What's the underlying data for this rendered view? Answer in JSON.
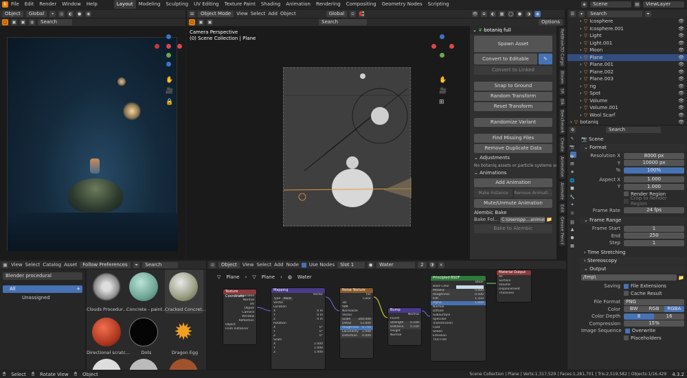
{
  "menu": [
    "File",
    "Edit",
    "Render",
    "Window",
    "Help"
  ],
  "workspaces": [
    "Layout",
    "Modeling",
    "Sculpting",
    "UV Editing",
    "Texture Paint",
    "Shading",
    "Animation",
    "Rendering",
    "Compositing",
    "Geometry Nodes",
    "Scripting"
  ],
  "active_workspace": "Layout",
  "top_right": {
    "scene": "Scene",
    "view_layer": "ViewLayer"
  },
  "left_viewport": {
    "mode": "Object",
    "orientation": "Global",
    "search": "Search"
  },
  "main_viewport": {
    "mode": "Object Mode",
    "menus": [
      "View",
      "Select",
      "Add",
      "Object"
    ],
    "orientation": "Global",
    "camera_label": "Camera Perspective",
    "collection_label": "(0) Scene Collection | Plane",
    "options": "Options",
    "search": "Search"
  },
  "npanel": {
    "title": "botaniq full",
    "buttons": {
      "spawn": "Spawn Asset",
      "convert_editable": "Convert to Editable",
      "convert_linked": "Convert to Linked",
      "snap": "Snap to Ground",
      "random_transform": "Random Transform",
      "reset_transform": "Reset Transform",
      "randomize_variant": "Randomize Variant",
      "find_missing": "Find Missing Files",
      "remove_duplicate": "Remove Duplicate Data",
      "add_animation": "Add Animation",
      "make_instance": "Make Instance",
      "remove_animation": "Remove Animati...",
      "mute_unmute": "Mute/Unmute Animation",
      "bake_alembic": "Bake to Alembic"
    },
    "adjustments_label": "Adjustments",
    "no_assets_msg": "No botaniq assets or particle systems sel...",
    "animations_label": "Animations",
    "alembic_label": "Alembic Bake",
    "bake_folder_label": "Bake Fol...",
    "bake_folder_path": "C:\\Users\\pp....animations"
  },
  "side_tabs": [
    "RetBrain3D Cargo",
    "Bloom",
    "SR",
    "Blk",
    "Benchmark",
    "Create",
    "Animation",
    "Animate",
    "Edit",
    "Grease Pencil"
  ],
  "outliner": {
    "search": "Search",
    "items": [
      {
        "name": "Icosphere",
        "selected": false
      },
      {
        "name": "Icosphere.001",
        "selected": false
      },
      {
        "name": "Light",
        "selected": false
      },
      {
        "name": "Light.001",
        "selected": false
      },
      {
        "name": "Moon",
        "selected": false
      },
      {
        "name": "Plane",
        "selected": true
      },
      {
        "name": "Plane.001",
        "selected": false
      },
      {
        "name": "Plane.002",
        "selected": false
      },
      {
        "name": "Plane.003",
        "selected": false
      },
      {
        "name": "rig",
        "selected": false
      },
      {
        "name": "Spot",
        "selected": false
      },
      {
        "name": "Volume",
        "selected": false
      },
      {
        "name": "Volume.001",
        "selected": false
      },
      {
        "name": "Wool Scarf",
        "selected": false
      },
      {
        "name": "botaniq",
        "selected": false
      }
    ]
  },
  "properties": {
    "search": "Search",
    "scene": "Scene",
    "format": {
      "title": "Format",
      "resolution_label": "Resolution X",
      "resolution_x": "8000 px",
      "y_label": "Y",
      "resolution_y": "10000 px",
      "pct_label": "%",
      "resolution_pct": "100%",
      "aspect_label": "Aspect X",
      "aspect_x": "1.000",
      "aspect_y": "1.000",
      "render_region": "Render Region",
      "crop_region": "Crop to Render Region",
      "frame_rate_label": "Frame Rate",
      "frame_rate": "24 fps"
    },
    "frame_range": {
      "title": "Frame Range",
      "start_label": "Frame Start",
      "start": "1",
      "end_label": "End",
      "end": "250",
      "step_label": "Step",
      "step": "1"
    },
    "time_stretching": "Time Stretching",
    "stereoscopy": "Stereoscopy",
    "output": {
      "title": "Output",
      "path": "/tmp\\",
      "saving_label": "Saving",
      "file_extensions": "File Extensions",
      "cache_result": "Cache Result",
      "file_format_label": "File Format",
      "file_format": "PNG",
      "color_label": "Color",
      "color_opts": [
        "BW",
        "RGB",
        "RGBA"
      ],
      "color_depth_label": "Color Depth",
      "color_depth_opts": [
        "8",
        "16"
      ],
      "compression_label": "Compression",
      "compression": "15%",
      "image_seq_label": "Image Sequence",
      "overwrite": "Overwrite",
      "placeholders": "Placeholders"
    }
  },
  "asset_browser": {
    "menus": [
      "View",
      "Select",
      "Catalog",
      "Asset"
    ],
    "follow": "Follow Preferences",
    "search": "Search",
    "library": "Blender procedural",
    "catalog_all": "All",
    "catalog_unassigned": "Unassigned",
    "assets": [
      "Clouds Procedur...",
      "Concrete - paint...",
      "Cracked Concret...",
      "Directional scratc...",
      "Dots",
      "Dragon Egg"
    ]
  },
  "node_editor": {
    "object": "Object",
    "menus": [
      "View",
      "Select",
      "Add",
      "Node"
    ],
    "use_nodes": "Use Nodes",
    "slot": "Slot 1",
    "material": "Water",
    "users": "2",
    "breadcrumb": [
      "Plane",
      "Plane",
      "Water"
    ],
    "nodes": {
      "texcoord": {
        "title": "Texture Coordinate",
        "rows": [
          "Generated",
          "Normal",
          "UV",
          "Object",
          "Camera",
          "Window",
          "Reflection"
        ],
        "object_label": "Object",
        "from_instancer": "From Instancer"
      },
      "mapping": {
        "title": "Mapping",
        "rows": [
          "Vector",
          "Type",
          "Point",
          "Vector",
          "Location",
          "X",
          "Y",
          "Z",
          "Rotation",
          "X",
          "Y",
          "Z",
          "Scale",
          "X",
          "Y",
          "Z"
        ],
        "values": [
          "0 m",
          "0 m",
          "0 m",
          "0°",
          "0°",
          "0°",
          "1.000",
          "1.000",
          "1.000"
        ]
      },
      "noise": {
        "title": "Noise Texture",
        "rows": [
          "Fac",
          "Color",
          "3D",
          "fBM",
          "Normalize",
          "Vector",
          "Scale",
          "Detail",
          "Roughness",
          "Lacunarity",
          "Distortion"
        ],
        "values": [
          "200.000",
          "12.000",
          "0.750",
          "2.000",
          "0.000"
        ]
      },
      "bump": {
        "title": "Bump",
        "rows": [
          "Normal",
          "Invert",
          "Strength",
          "Distance",
          "Height",
          "Normal"
        ],
        "values": [
          "0.100",
          "0.100"
        ]
      },
      "bsdf": {
        "title": "Principled BSDF",
        "rows": [
          "BSDF",
          "Base Color",
          "Metallic",
          "Roughness",
          "IOR",
          "Alpha",
          "Normal",
          "Diffuse",
          "Subsurface",
          "Specular",
          "Transmission",
          "Coat",
          "Sheen",
          "Emission",
          "Thin Film"
        ],
        "values": [
          "0.000",
          "0.500",
          "1.333",
          "1.000"
        ]
      },
      "output": {
        "title": "Material Output",
        "rows": [
          "All",
          "Surface",
          "Volume",
          "Displacement",
          "Thickness"
        ]
      }
    }
  },
  "status": {
    "select": "Select",
    "rotate": "Rotate View",
    "object": "Object",
    "stats": "Scene Collection | Plane | Verts:1,317,529 | Faces:1,281,701 | Tris:2,519,582 | Objects:1/16,429",
    "version": "4.3.2"
  }
}
